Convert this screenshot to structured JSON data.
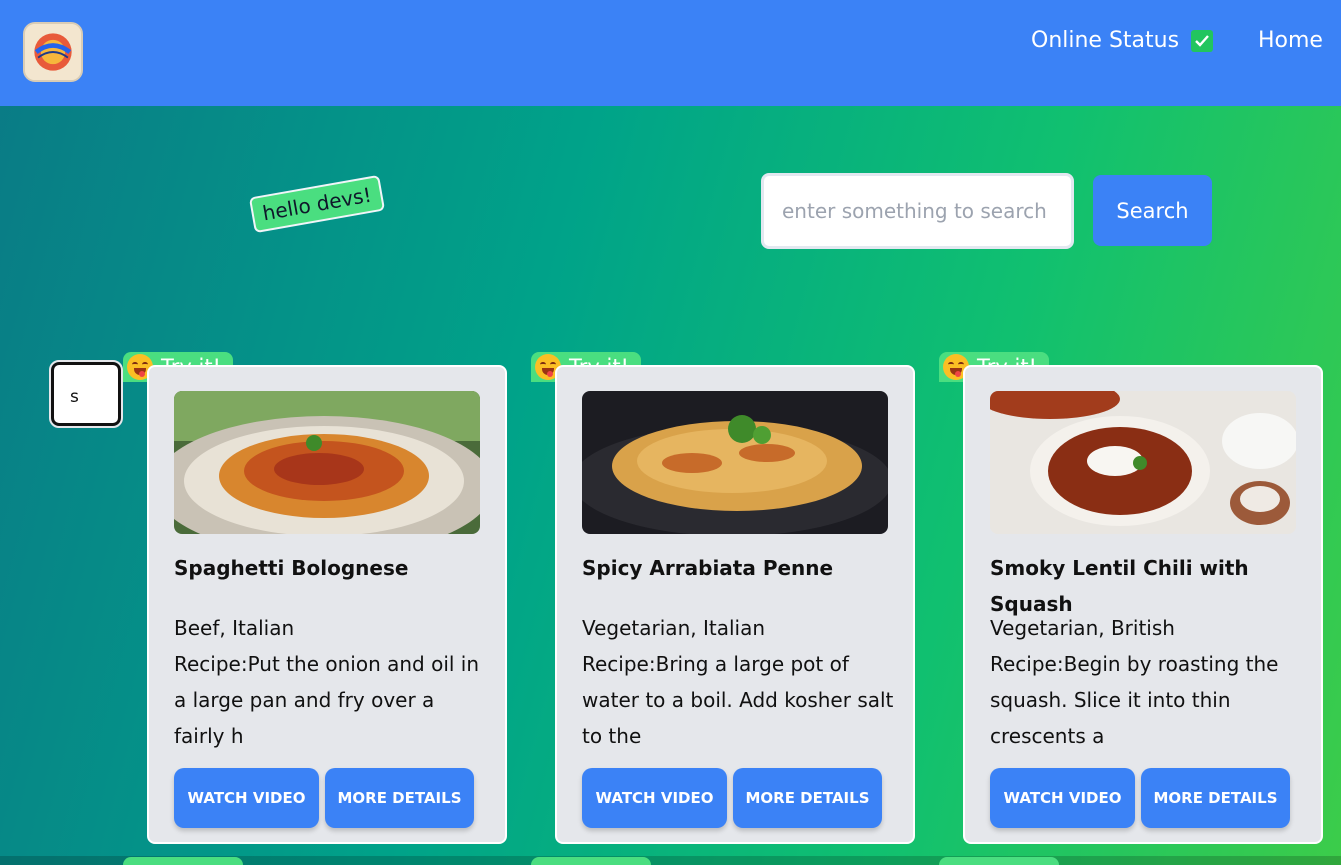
{
  "nav": {
    "status_label": "Online Status",
    "home_label": "Home",
    "logo_icon": "app-logo-icon",
    "status_icon": "checkmark-icon"
  },
  "hello_tag": "hello devs!",
  "search": {
    "placeholder": "enter something to search",
    "button_label": "Search"
  },
  "side_input": {
    "value": "s"
  },
  "cards": [
    {
      "badge": "Try it!",
      "badge_icon": "yum-face-icon",
      "image_icon": "spaghetti-image",
      "title": "Spaghetti Bolognese",
      "tags": "Beef, Italian",
      "recipe": "Recipe:Put the onion and oil in a large pan and fry over a fairly h",
      "watch_label": "Watch Video",
      "more_label": "More Details"
    },
    {
      "badge": "Try it!",
      "badge_icon": "yum-face-icon",
      "image_icon": "penne-image",
      "title": "Spicy Arrabiata Penne",
      "tags": "Vegetarian, Italian",
      "recipe": "Recipe:Bring a large pot of water to a boil. Add kosher salt to the",
      "watch_label": "Watch Video",
      "more_label": "More Details"
    },
    {
      "badge": "Try it!",
      "badge_icon": "yum-face-icon",
      "image_icon": "lentil-chili-image",
      "title": "Smoky Lentil Chili with Squash",
      "tags": "Vegetarian, British",
      "recipe": "Recipe:Begin by roasting the squash. Slice it into thin crescents a",
      "watch_label": "Watch Video",
      "more_label": "More Details"
    }
  ],
  "colors": {
    "navbar": "#3b82f6",
    "button": "#3b82f6",
    "badge": "#4ade80",
    "card": "#e5e7eb"
  }
}
